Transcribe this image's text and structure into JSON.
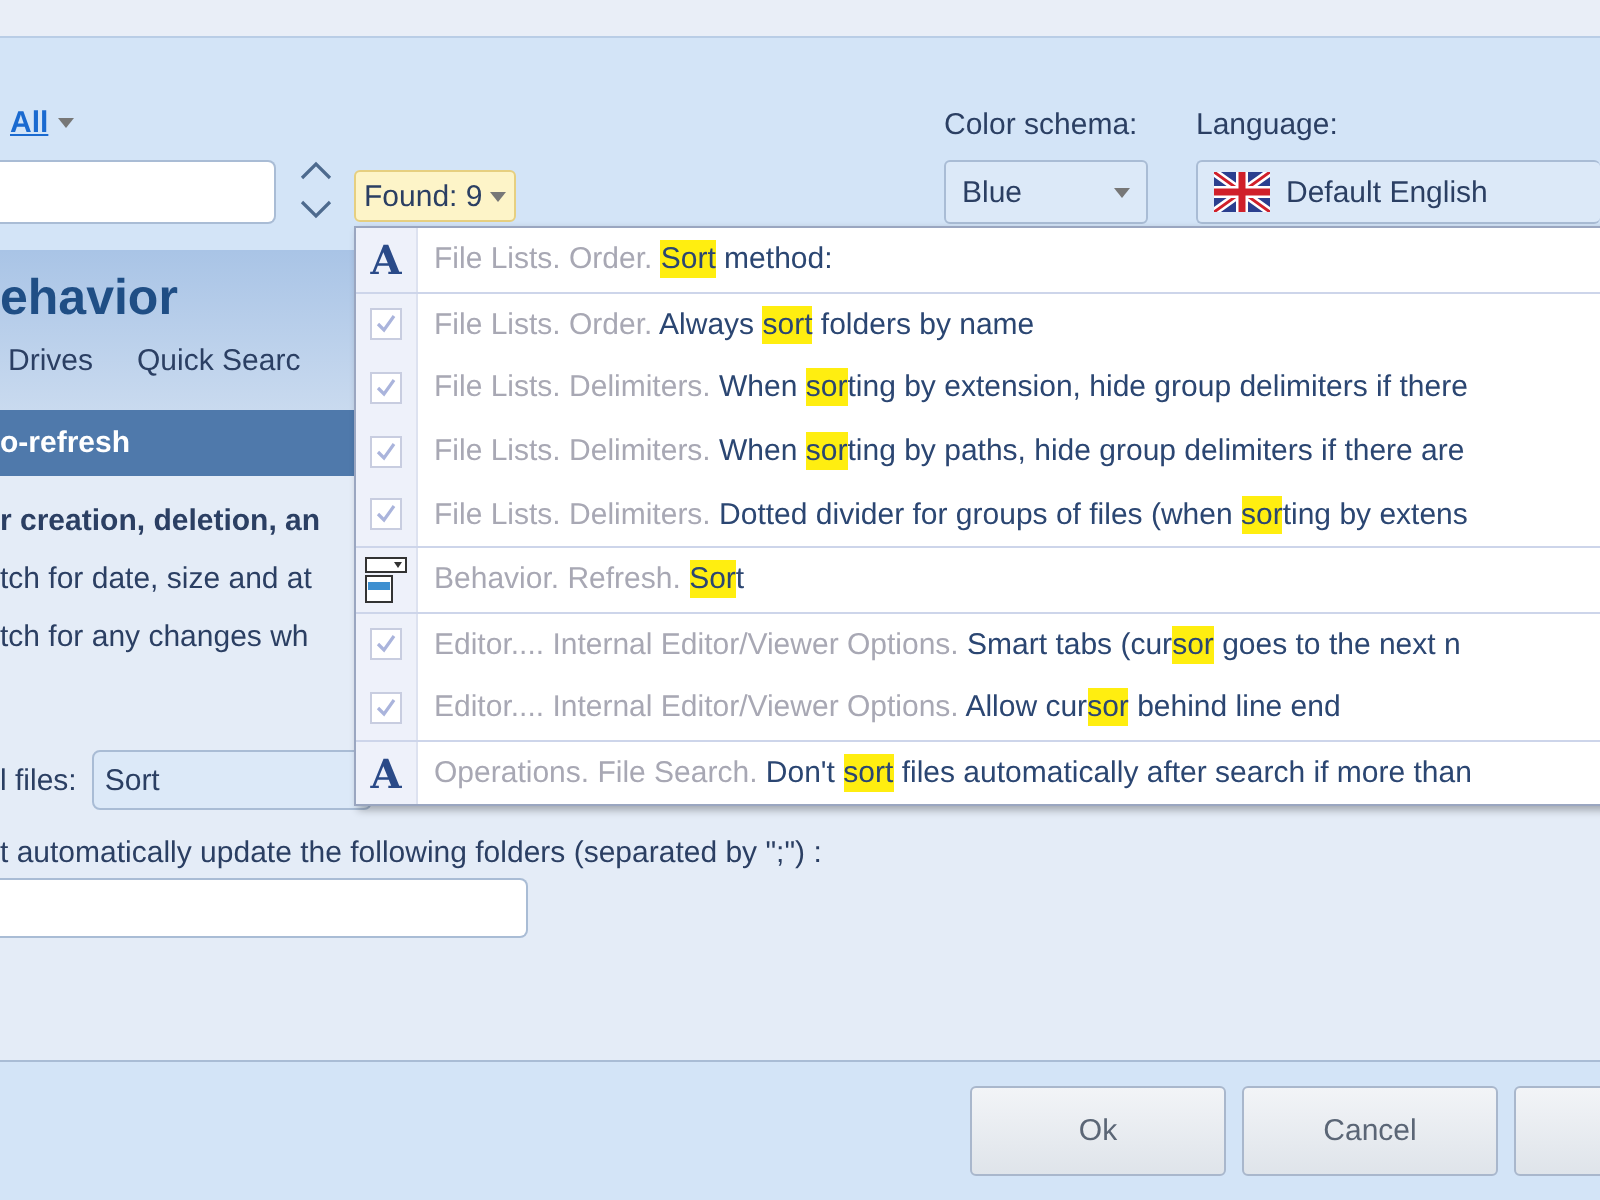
{
  "filter": {
    "label": "All"
  },
  "found_button": {
    "label": "Found: 9"
  },
  "color_schema": {
    "label": "Color schema:",
    "value": "Blue"
  },
  "language": {
    "label": "Language:",
    "value": "Default English"
  },
  "page_title": "ehavior",
  "tabs": [
    {
      "label": "Drives"
    },
    {
      "label": "Quick Searc"
    }
  ],
  "section": "o-refresh",
  "options": [
    {
      "kind": "heading",
      "text": "r creation, deletion, an"
    },
    {
      "kind": "option",
      "text": "tch for date, size and at"
    },
    {
      "kind": "option",
      "text": "tch for any changes wh"
    }
  ],
  "sort_field": {
    "label": "l files:",
    "value": "Sort"
  },
  "folders_field": {
    "label": "t automatically update the following folders (separated by \";\") :"
  },
  "results": [
    {
      "kind": "text",
      "glyph": "A",
      "path": "File Lists. Order.",
      "match": "Sort",
      "after": " method:"
    },
    {
      "kind": "checkbox",
      "checked": true,
      "path": "File Lists. Order.",
      "before": "Always ",
      "match": "sort",
      "after": " folders by name"
    },
    {
      "kind": "checkbox",
      "checked": true,
      "path": "File Lists. Delimiters.",
      "before": "When ",
      "match": "sor",
      "after": "ting by extension, hide group delimiters if there"
    },
    {
      "kind": "checkbox",
      "checked": true,
      "path": "File Lists. Delimiters.",
      "before": "When ",
      "match": "sor",
      "after": "ting by paths, hide group delimiters if there are"
    },
    {
      "kind": "checkbox",
      "checked": true,
      "path": "File Lists. Delimiters.",
      "before": "Dotted divider for groups of files (when ",
      "match": "sor",
      "after": "ting by extens"
    },
    {
      "kind": "combo",
      "path": "Behavior. Refresh.",
      "match": "Sor",
      "after": "t"
    },
    {
      "kind": "checkbox",
      "checked": true,
      "path": "Editor.... Internal Editor/Viewer Options.",
      "before": "Smart tabs (cur",
      "match": "sor",
      "after": " goes to the next n"
    },
    {
      "kind": "checkbox",
      "checked": true,
      "path": "Editor.... Internal Editor/Viewer Options.",
      "before": "Allow cur",
      "match": "sor",
      "after": " behind line end"
    },
    {
      "kind": "text",
      "glyph": "A",
      "path": "Operations. File Search.",
      "before": "Don't ",
      "match": "sort",
      "after": " files automatically after search if more than"
    }
  ],
  "buttons": [
    {
      "label": "Ok"
    },
    {
      "label": "Cancel"
    }
  ]
}
